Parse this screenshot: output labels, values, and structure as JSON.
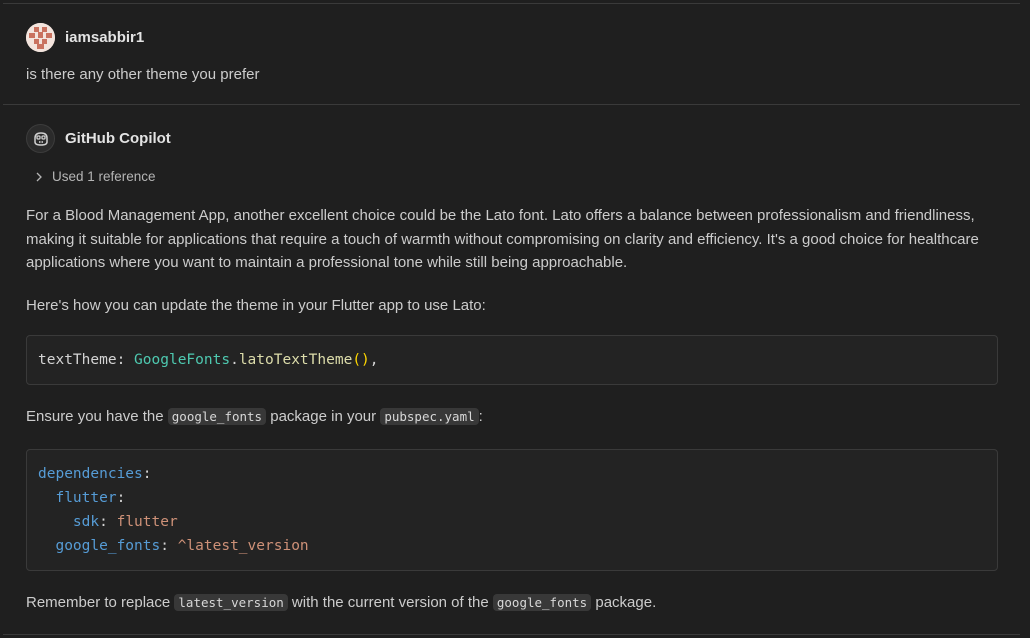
{
  "user_message": {
    "author": "iamsabbir1",
    "text": "is there any other theme you prefer"
  },
  "assistant_message": {
    "author": "GitHub Copilot",
    "reference_toggle": "Used 1 reference",
    "paragraph1": "For a Blood Management App, another excellent choice could be the Lato font. Lato offers a balance between professionalism and friendliness, making it suitable for applications that require a touch of warmth without compromising on clarity and efficiency. It's a good choice for healthcare applications where you want to maintain a professional tone while still being approachable.",
    "paragraph2": "Here's how you can update the theme in your Flutter app to use Lato:",
    "code1": {
      "key": "textTheme",
      "colon": ": ",
      "class_name": "GoogleFonts",
      "dot": ".",
      "method": "latoTextTheme",
      "parens": "()",
      "trailing": ","
    },
    "paragraph3": {
      "before": "Ensure you have the ",
      "code_a": "google_fonts",
      "middle": " package in your ",
      "code_b": "pubspec.yaml",
      "after": ":"
    },
    "code2": {
      "line1_key": "dependencies",
      "line2_key": "flutter",
      "line3_key": "sdk",
      "line3_value": "flutter",
      "line4_key": "google_fonts",
      "line4_value": "^latest_version",
      "colon": ":"
    },
    "paragraph4": {
      "before": "Remember to replace ",
      "code_a": "latest_version",
      "middle": " with the current version of the ",
      "code_b": "google_fonts",
      "after": " package."
    }
  },
  "colors": {
    "background": "#1f1f1f",
    "text": "#cccccc",
    "code_key": "#569cd6",
    "code_class": "#4ec9b0",
    "code_method": "#dcdcaa",
    "code_string": "#ce9178"
  },
  "icons": {
    "avatar_user": "identicon-avatar",
    "avatar_bot": "copilot-icon",
    "reference": "chevron-right-icon"
  }
}
